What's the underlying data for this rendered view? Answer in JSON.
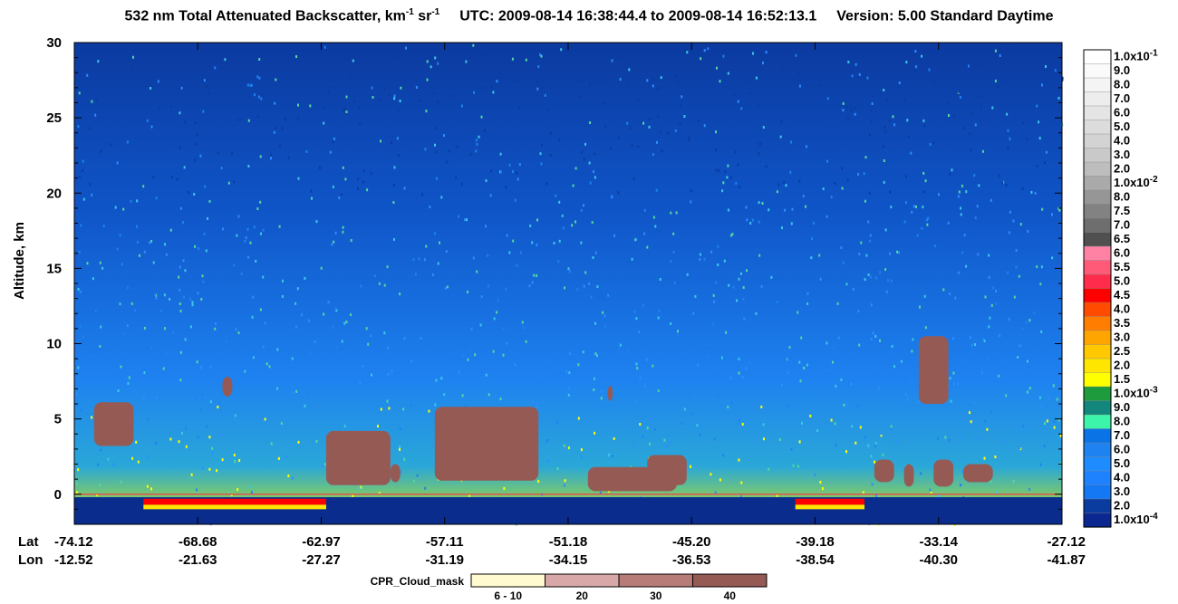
{
  "title": {
    "main": "532 nm Total Attenuated Backscatter, km",
    "unit_sup1": "-1",
    "sr": " sr",
    "unit_sup2": "-1",
    "utc": "UTC:  2009-08-14 16:38:44.4  to  2009-08-14 16:52:13.1",
    "version": "Version: 5.00  Standard  Daytime"
  },
  "chart_data": {
    "type": "heatmap",
    "ylabel": "Altitude, km",
    "ylim": [
      -2,
      30
    ],
    "y_ticks": [
      0,
      5,
      10,
      15,
      20,
      25,
      30
    ],
    "x_row_labels": [
      "Lat",
      "Lon"
    ],
    "x_ticks": [
      {
        "lat": "-74.12",
        "lon": "-12.52"
      },
      {
        "lat": "-68.68",
        "lon": "-21.63"
      },
      {
        "lat": "-62.97",
        "lon": "-27.27"
      },
      {
        "lat": "-57.11",
        "lon": "-31.19"
      },
      {
        "lat": "-51.18",
        "lon": "-34.15"
      },
      {
        "lat": "-45.20",
        "lon": "-36.53"
      },
      {
        "lat": "-39.18",
        "lon": "-38.54"
      },
      {
        "lat": "-33.14",
        "lon": "-40.30"
      },
      {
        "lat": "-27.12",
        "lon": "-41.87"
      }
    ],
    "cloud_mask_regions": [
      {
        "x0": 0.02,
        "x1": 0.06,
        "y0": 3.2,
        "y1": 6.1
      },
      {
        "x0": 0.15,
        "x1": 0.16,
        "y0": 6.5,
        "y1": 7.8
      },
      {
        "x0": 0.255,
        "x1": 0.32,
        "y0": 0.6,
        "y1": 4.2
      },
      {
        "x0": 0.32,
        "x1": 0.33,
        "y0": 0.8,
        "y1": 2.0
      },
      {
        "x0": 0.365,
        "x1": 0.47,
        "y0": 0.9,
        "y1": 5.8
      },
      {
        "x0": 0.395,
        "x1": 0.415,
        "y0": 2.5,
        "y1": 4.9
      },
      {
        "x0": 0.52,
        "x1": 0.61,
        "y0": 0.2,
        "y1": 1.8
      },
      {
        "x0": 0.58,
        "x1": 0.62,
        "y0": 0.6,
        "y1": 2.6
      },
      {
        "x0": 0.54,
        "x1": 0.545,
        "y0": 6.2,
        "y1": 7.2
      },
      {
        "x0": 0.81,
        "x1": 0.83,
        "y0": 0.8,
        "y1": 2.3
      },
      {
        "x0": 0.84,
        "x1": 0.85,
        "y0": 0.5,
        "y1": 2.0
      },
      {
        "x0": 0.87,
        "x1": 0.89,
        "y0": 0.5,
        "y1": 2.3
      },
      {
        "x0": 0.855,
        "x1": 0.885,
        "y0": 6.0,
        "y1": 10.5
      },
      {
        "x0": 0.9,
        "x1": 0.93,
        "y0": 0.8,
        "y1": 2.0
      }
    ],
    "surface_return_altitude_km": 0,
    "colorbar": {
      "entries": [
        {
          "label": "1.0x10",
          "exp": "-1",
          "color": "#ffffff"
        },
        {
          "label": "9.0",
          "color": "#fafafa"
        },
        {
          "label": "8.0",
          "color": "#f4f4f4"
        },
        {
          "label": "7.0",
          "color": "#ededed"
        },
        {
          "label": "6.0",
          "color": "#e4e4e4"
        },
        {
          "label": "5.0",
          "color": "#dcdcdc"
        },
        {
          "label": "4.0",
          "color": "#d3d3d3"
        },
        {
          "label": "3.0",
          "color": "#c9c9c9"
        },
        {
          "label": "2.0",
          "color": "#bdbdbd"
        },
        {
          "label": "1.0x10",
          "exp": "-2",
          "color": "#aaaaaa"
        },
        {
          "label": "8.0",
          "color": "#969696"
        },
        {
          "label": "7.5",
          "color": "#828282"
        },
        {
          "label": "7.0",
          "color": "#6e6e6e"
        },
        {
          "label": "6.5",
          "color": "#505050"
        },
        {
          "label": "6.0",
          "color": "#ff82a5"
        },
        {
          "label": "5.5",
          "color": "#ff5a78"
        },
        {
          "label": "5.0",
          "color": "#ff2d4b"
        },
        {
          "label": "4.5",
          "color": "#ff0000"
        },
        {
          "label": "4.0",
          "color": "#ff4b00"
        },
        {
          "label": "3.5",
          "color": "#ff7d00"
        },
        {
          "label": "3.0",
          "color": "#ffa500"
        },
        {
          "label": "2.5",
          "color": "#ffc800"
        },
        {
          "label": "2.0",
          "color": "#ffe600"
        },
        {
          "label": "1.5",
          "color": "#ffff00"
        },
        {
          "label": "1.0x10",
          "exp": "-3",
          "color": "#1e9b3c"
        },
        {
          "label": "9.0",
          "color": "#14877d"
        },
        {
          "label": "8.0",
          "color": "#3cf5aa"
        },
        {
          "label": "7.0",
          "color": "#0a73e6"
        },
        {
          "label": "6.0",
          "color": "#1e82f0"
        },
        {
          "label": "5.0",
          "color": "#1e8cff"
        },
        {
          "label": "4.0",
          "color": "#1e82ff"
        },
        {
          "label": "3.0",
          "color": "#1478f5"
        },
        {
          "label": "2.0",
          "color": "#0a3ca0"
        },
        {
          "label": "1.0x10",
          "exp": "-4",
          "color": "#0a2890"
        }
      ]
    },
    "cloud_mask_legend": {
      "title": "CPR_Cloud_mask",
      "bins": [
        {
          "label": "6 - 10",
          "color": "#fffad0"
        },
        {
          "label": "20",
          "color": "#d8a8a8"
        },
        {
          "label": "30",
          "color": "#b87c78"
        },
        {
          "label": "40",
          "color": "#965a55"
        }
      ]
    }
  }
}
